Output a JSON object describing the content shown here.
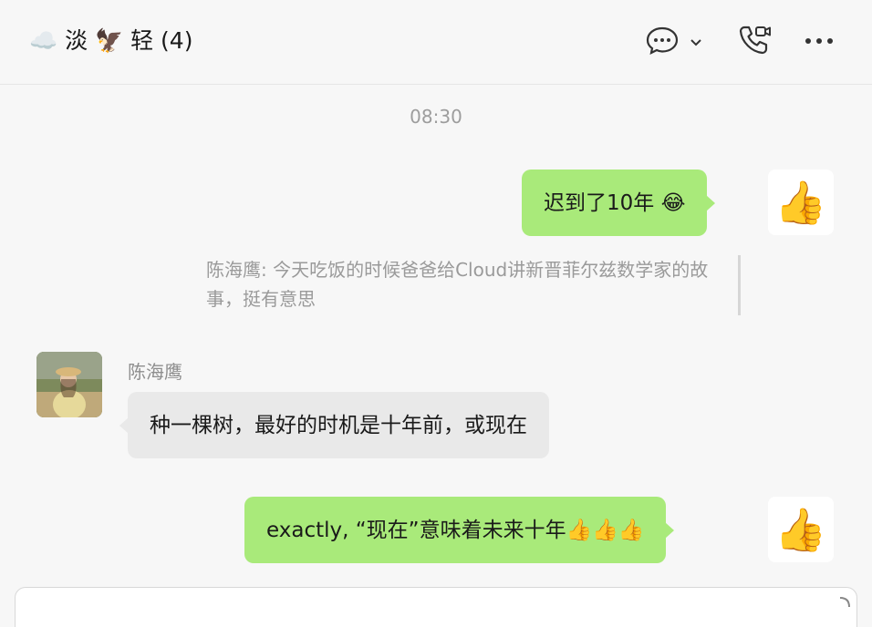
{
  "header": {
    "title": "☁️ 淡 🦅 轻 (4)",
    "icons": {
      "chat": "chat-bubble-icon",
      "chevron": "chevron-down-icon",
      "call": "video-call-icon",
      "more": "more-dots-icon"
    }
  },
  "timestamp": "08:30",
  "messages": [
    {
      "from": "me",
      "text": "迟到了10年 😂",
      "avatar": "thumbs-up"
    },
    {
      "from": "quote",
      "text": "陈海鹰: 今天吃饭的时候爸爸给Cloud讲新晋菲尔兹数学家的故事，挺有意思"
    },
    {
      "from": "other",
      "sender": "陈海鹰",
      "text": "种一棵树，最好的时机是十年前，或现在",
      "avatar": "photo"
    },
    {
      "from": "me",
      "text": "exactly, “现在”意味着未来十年👍👍👍",
      "avatar": "thumbs-up"
    }
  ],
  "colors": {
    "my_bubble": "#a9ea7a",
    "other_bubble": "#e9e9e9",
    "background": "#f7f7f7"
  }
}
